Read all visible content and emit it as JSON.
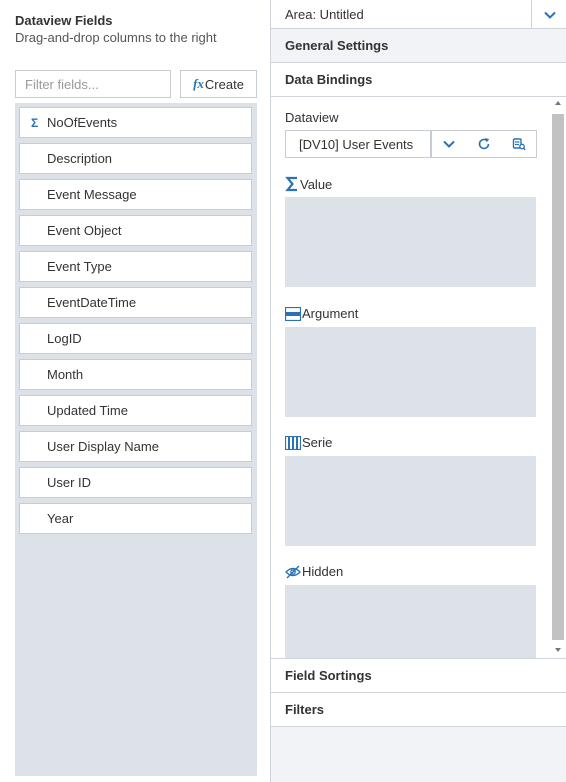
{
  "left": {
    "title": "Dataview Fields",
    "subtitle": "Drag-and-drop columns to the right",
    "filter_placeholder": "Filter fields...",
    "create_label": "Create",
    "create_icon": "fx",
    "fields": [
      {
        "label": "NoOfEvents",
        "icon": "Σ"
      },
      {
        "label": "Description"
      },
      {
        "label": "Event Message"
      },
      {
        "label": "Event Object"
      },
      {
        "label": "Event Type"
      },
      {
        "label": "EventDateTime"
      },
      {
        "label": "LogID"
      },
      {
        "label": "Month"
      },
      {
        "label": "Updated Time"
      },
      {
        "label": "User Display Name"
      },
      {
        "label": "User ID"
      },
      {
        "label": "Year"
      }
    ]
  },
  "right": {
    "area_label": "Area: Untitled",
    "sections": {
      "general": "General Settings",
      "bindings": "Data Bindings",
      "sortings": "Field Sortings",
      "filters": "Filters"
    },
    "dataview_label": "Dataview",
    "dataview_value": "[DV10] User Events",
    "drop_zones": {
      "value": "Value",
      "argument": "Argument",
      "serie": "Serie",
      "hidden": "Hidden"
    }
  },
  "colors": {
    "accent": "#2a72b5",
    "zone_bg": "#dde1e8",
    "panel_bg": "#f1f3f6",
    "border": "#c8cdd3"
  }
}
